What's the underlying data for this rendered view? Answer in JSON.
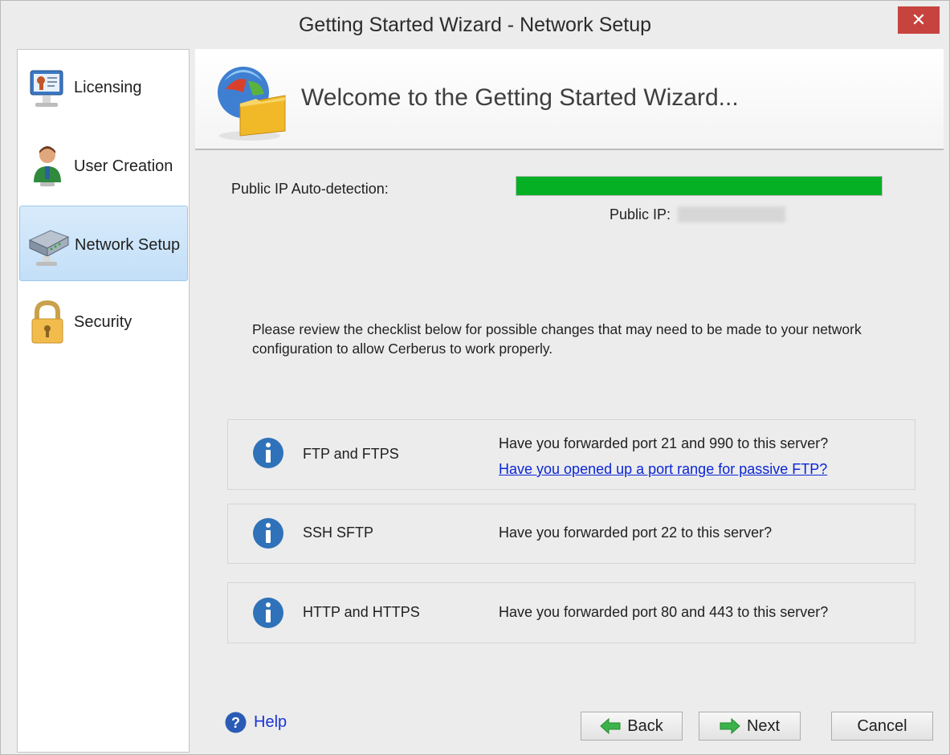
{
  "window": {
    "title": "Getting Started Wizard - Network Setup",
    "close_glyph": "✕"
  },
  "sidebar": {
    "items": [
      {
        "label": "Licensing",
        "icon": "certificate-icon"
      },
      {
        "label": "User Creation",
        "icon": "user-icon"
      },
      {
        "label": "Network Setup",
        "icon": "router-icon",
        "selected": true
      },
      {
        "label": "Security",
        "icon": "lock-icon"
      }
    ]
  },
  "header": {
    "title": "Welcome to the Getting Started Wizard..."
  },
  "ip_detection": {
    "label": "Public IP Auto-detection:",
    "progress_percent": 100,
    "public_ip_label": "Public IP:",
    "public_ip_value": ""
  },
  "note": "Please review the checklist below for possible changes that may need to be made to your network configuration to allow Cerberus to work properly.",
  "checklist": [
    {
      "name": "FTP and FTPS",
      "question": "Have you forwarded port 21 and 990 to this server?",
      "link": "Have you opened up a port range for passive FTP?"
    },
    {
      "name": "SSH SFTP",
      "question": "Have you forwarded port 22 to this server?"
    },
    {
      "name": "HTTP and HTTPS",
      "question": "Have you forwarded port 80 and 443 to this server?"
    }
  ],
  "footer": {
    "help": "Help",
    "back": "Back",
    "next": "Next",
    "cancel": "Cancel"
  },
  "colors": {
    "progress": "#06b025",
    "close": "#c7433d",
    "link": "#0b26d7",
    "info_icon": "#2f72b9",
    "selected_bg": "#c3dff8"
  }
}
